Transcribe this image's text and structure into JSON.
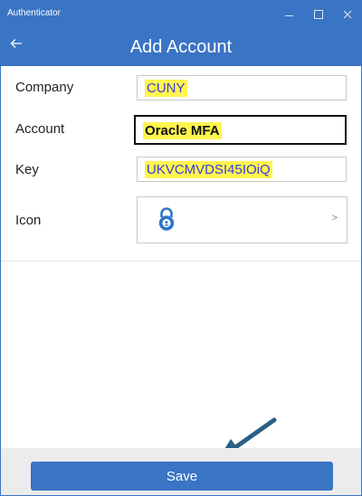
{
  "window": {
    "title": "Authenticator"
  },
  "header": {
    "title": "Add Account"
  },
  "form": {
    "company_label": "Company",
    "company_value": "CUNY",
    "account_label": "Account",
    "account_value": "Oracle MFA",
    "key_label": "Key",
    "key_value": "UKVCMVDSI45IOiQ",
    "icon_label": "Icon",
    "icon_name": "lock-icon",
    "chevron": ">"
  },
  "footer": {
    "save_label": "Save"
  },
  "colors": {
    "accent": "#3a74c4",
    "highlight": "#fff44f",
    "annotation_arrow": "#2a5f86"
  }
}
